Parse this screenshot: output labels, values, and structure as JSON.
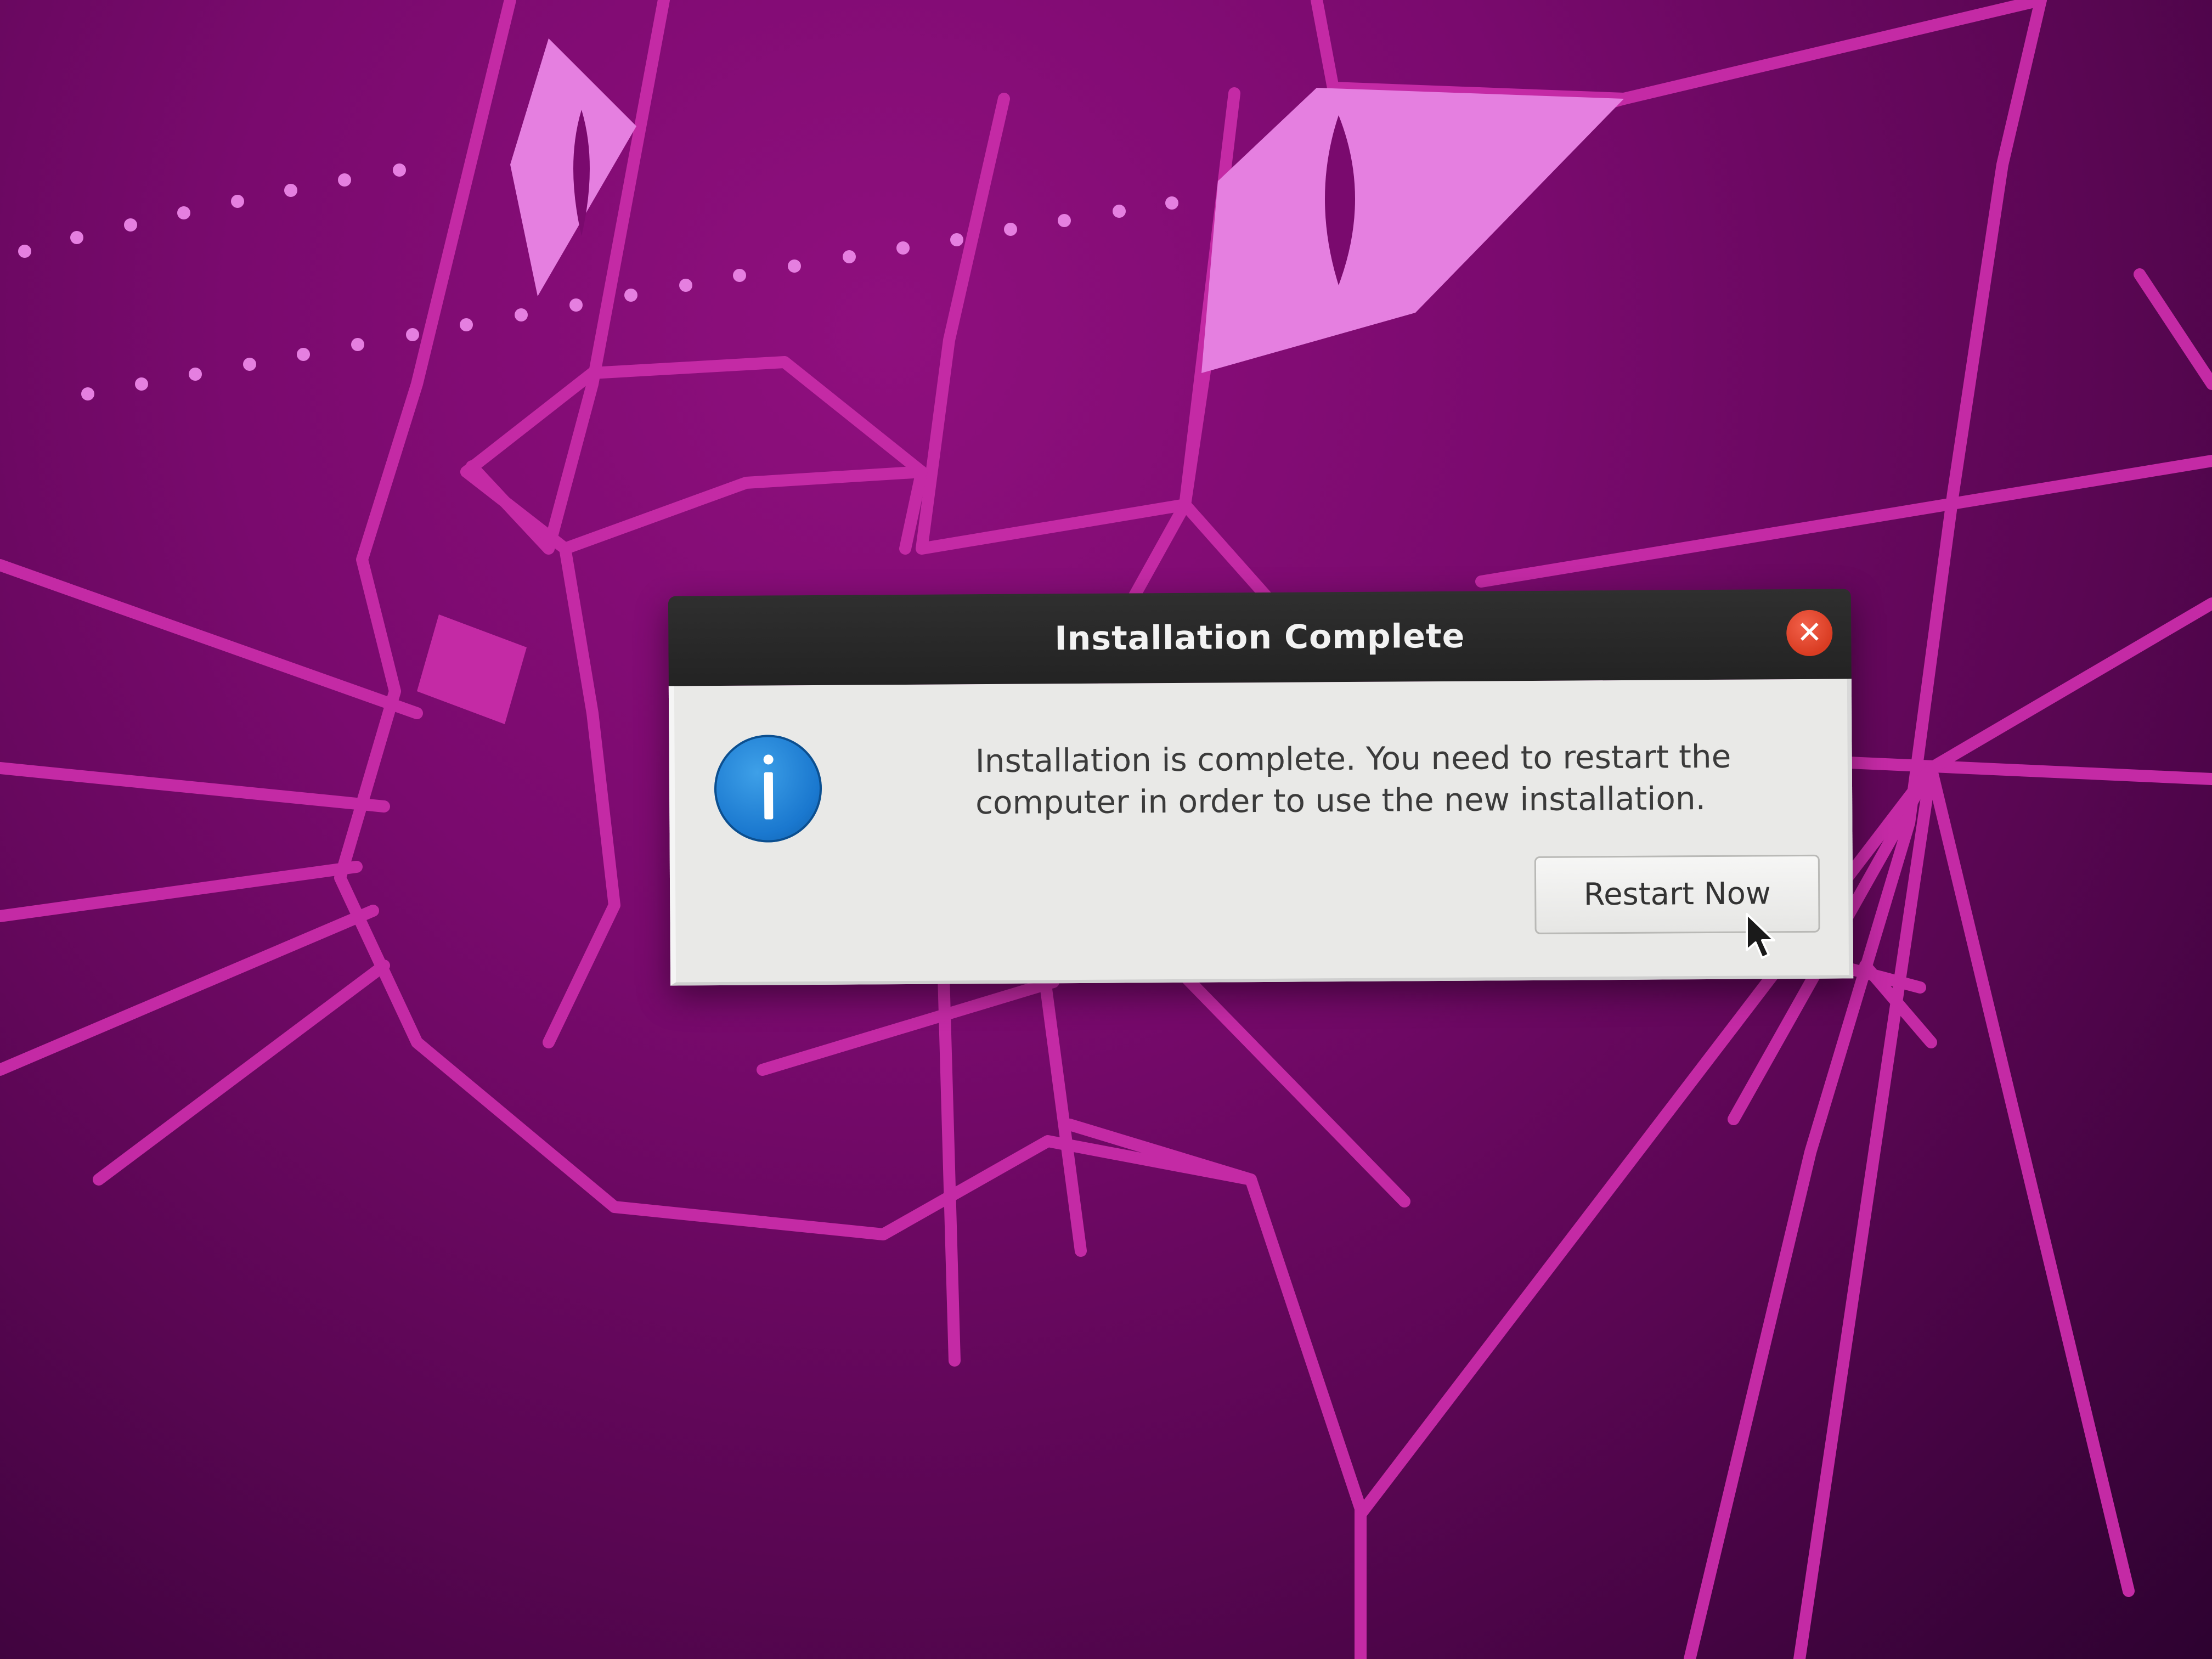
{
  "dialog": {
    "title": "Installation Complete",
    "close_label": "✕",
    "icon": "info-icon",
    "message": "Installation is complete. You need to restart the computer in order to use the new installation.",
    "restart_label": "Restart Now"
  },
  "colors": {
    "wallpaper_base": "#7a0a6e",
    "wallpaper_lines": "#c42aa5",
    "wallpaper_eye": "#e57fe0",
    "titlebar": "#2a2a2a",
    "close_button": "#e0432b",
    "dialog_body": "#e9e9e7",
    "info_icon": "#1a78cf"
  }
}
